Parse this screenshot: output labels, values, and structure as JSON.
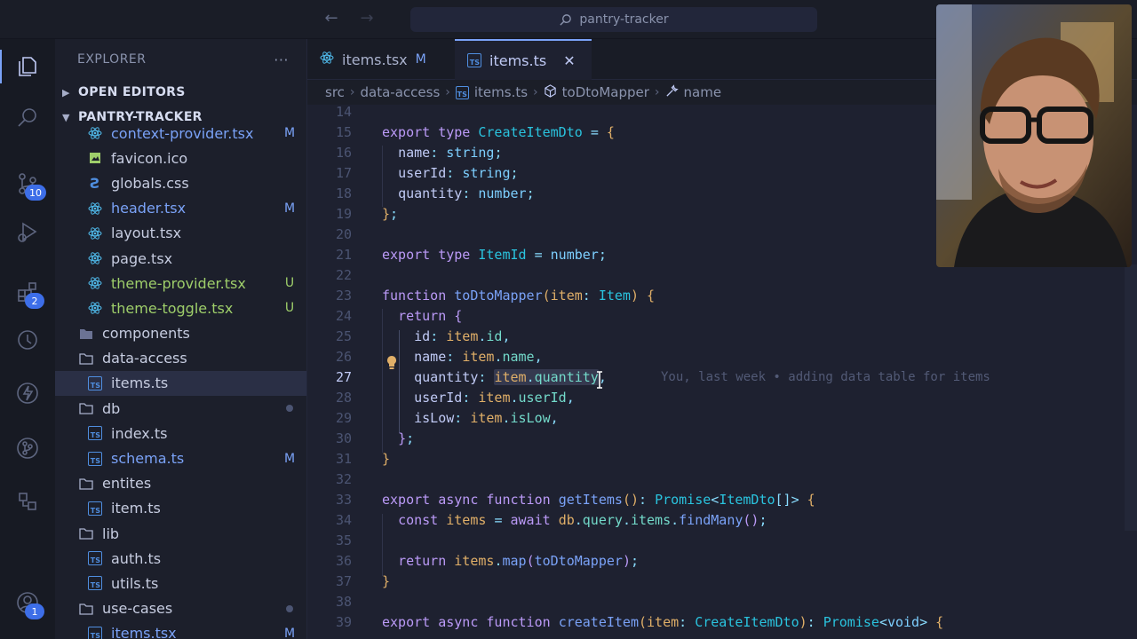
{
  "search": {
    "text": "pantry-tracker"
  },
  "activity": {
    "scm_badge": "10",
    "extensions_badge": "2",
    "accounts_badge": "1"
  },
  "explorer": {
    "title": "EXPLORER",
    "more": "···",
    "open_editors": "OPEN EDITORS",
    "project": "PANTRY-TRACKER",
    "items": [
      {
        "name": "context-provider.tsx",
        "status": "M"
      },
      {
        "name": "favicon.ico",
        "status": ""
      },
      {
        "name": "globals.css",
        "status": ""
      },
      {
        "name": "header.tsx",
        "status": "M"
      },
      {
        "name": "layout.tsx",
        "status": ""
      },
      {
        "name": "page.tsx",
        "status": ""
      },
      {
        "name": "theme-provider.tsx",
        "status": "U"
      },
      {
        "name": "theme-toggle.tsx",
        "status": "U"
      },
      {
        "name": "components",
        "status": ""
      },
      {
        "name": "data-access",
        "status": ""
      },
      {
        "name": "items.ts",
        "status": ""
      },
      {
        "name": "db",
        "status": ""
      },
      {
        "name": "index.ts",
        "status": ""
      },
      {
        "name": "schema.ts",
        "status": "M"
      },
      {
        "name": "entites",
        "status": ""
      },
      {
        "name": "item.ts",
        "status": ""
      },
      {
        "name": "lib",
        "status": ""
      },
      {
        "name": "auth.ts",
        "status": ""
      },
      {
        "name": "utils.ts",
        "status": ""
      },
      {
        "name": "use-cases",
        "status": ""
      },
      {
        "name": "items.tsx",
        "status": "M"
      }
    ]
  },
  "tabs": [
    {
      "label": "items.tsx",
      "status": "M"
    },
    {
      "label": "items.ts",
      "close": "✕"
    }
  ],
  "breadcrumb": [
    "src",
    "data-access",
    "items.ts",
    "toDtoMapper",
    "name"
  ],
  "editor": {
    "line_numbers": [
      "14",
      "15",
      "16",
      "17",
      "18",
      "19",
      "20",
      "21",
      "22",
      "23",
      "24",
      "25",
      "26",
      "27",
      "28",
      "29",
      "30",
      "31",
      "32",
      "33",
      "34",
      "35",
      "36",
      "37",
      "38",
      "39"
    ],
    "current_line": "27",
    "blame": "You, last week • adding data table for items"
  },
  "colors": {
    "accent": "#7aa2f7",
    "modified": "#7aa2f7",
    "untracked": "#9ece6a",
    "badge": "#3d6ee8"
  }
}
